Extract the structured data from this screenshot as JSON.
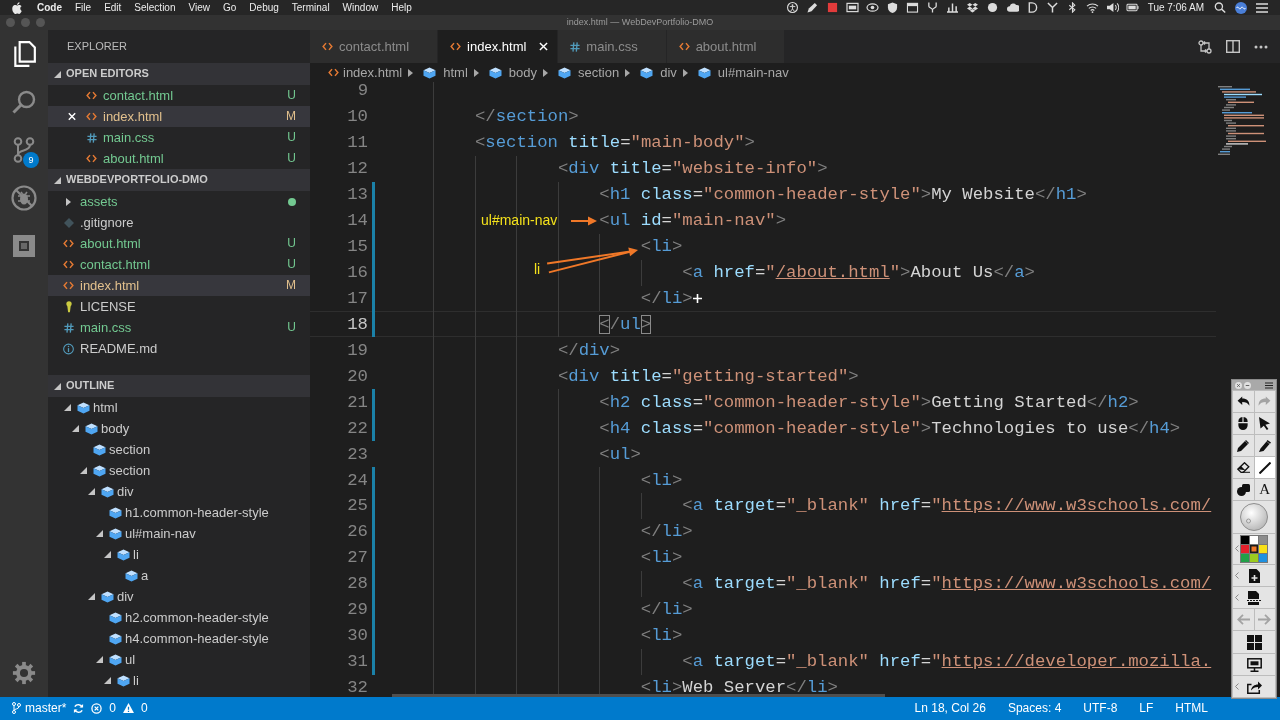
{
  "menu_bar": {
    "app": "Code",
    "menus": [
      "File",
      "Edit",
      "Selection",
      "View",
      "Go",
      "Debug",
      "Terminal",
      "Window",
      "Help"
    ],
    "clock": "Tue 7:06 AM"
  },
  "window": {
    "title": "index.html — WebDevPortfolio-DMO"
  },
  "activity_bar": {
    "items": [
      {
        "kind": "explorer",
        "selected": true
      },
      {
        "kind": "search",
        "selected": false
      },
      {
        "kind": "source_control",
        "selected": false,
        "badge": "9"
      },
      {
        "kind": "debug",
        "selected": false
      },
      {
        "kind": "extensions",
        "selected": false
      }
    ]
  },
  "sidebar": {
    "title": "EXPLORER",
    "open_editors": {
      "title": "OPEN EDITORS",
      "expanded": true,
      "items": [
        {
          "name": "contact.html",
          "kind": "html",
          "status": "U",
          "untracked": true,
          "selected": false
        },
        {
          "name": "index.html",
          "kind": "html",
          "status": "M",
          "untracked": false,
          "selected": true
        },
        {
          "name": "main.css",
          "kind": "css",
          "status": "U",
          "untracked": true,
          "selected": false
        },
        {
          "name": "about.html",
          "kind": "html",
          "status": "U",
          "untracked": true,
          "selected": false
        }
      ]
    },
    "folder": {
      "title": "WEBDEVPORTFOLIO-DMO",
      "expanded": true,
      "items": [
        {
          "name": "assets",
          "kind": "folder",
          "expanded": false,
          "untracked": true,
          "selected": false
        },
        {
          "name": ".gitignore",
          "kind": "gitignore",
          "selected": false
        },
        {
          "name": "about.html",
          "kind": "html",
          "status": "U",
          "untracked": true,
          "selected": false
        },
        {
          "name": "contact.html",
          "kind": "html",
          "status": "U",
          "untracked": true,
          "selected": false
        },
        {
          "name": "index.html",
          "kind": "html",
          "status": "M",
          "untracked": false,
          "selected": true
        },
        {
          "name": "LICENSE",
          "kind": "license",
          "selected": false
        },
        {
          "name": "main.css",
          "kind": "css",
          "status": "U",
          "untracked": true,
          "selected": false
        },
        {
          "name": "README.md",
          "kind": "readme",
          "selected": false
        }
      ]
    },
    "outline": {
      "title": "OUTLINE",
      "expanded": true,
      "items": [
        {
          "label": "html",
          "expanded": true,
          "children": [
            {
              "label": "body",
              "expanded": true,
              "children": [
                {
                  "label": "section"
                },
                {
                  "label": "section",
                  "expanded": true,
                  "children": [
                    {
                      "label": "div",
                      "expanded": true,
                      "children": [
                        {
                          "label": "h1.common-header-style"
                        },
                        {
                          "label": "ul#main-nav",
                          "expanded": true,
                          "children": [
                            {
                              "label": "li",
                              "expanded": true,
                              "children": [
                                {
                                  "label": "a"
                                }
                              ]
                            }
                          ]
                        }
                      ]
                    },
                    {
                      "label": "div",
                      "expanded": true,
                      "children": [
                        {
                          "label": "h2.common-header-style"
                        },
                        {
                          "label": "h4.common-header-style"
                        },
                        {
                          "label": "ul",
                          "expanded": true,
                          "children": [
                            {
                              "label": "li",
                              "expanded": true
                            }
                          ]
                        }
                      ]
                    }
                  ]
                }
              ]
            }
          ]
        }
      ]
    }
  },
  "tabs": [
    {
      "label": "contact.html",
      "kind": "html",
      "selected": false
    },
    {
      "label": "index.html",
      "kind": "html",
      "selected": true
    },
    {
      "label": "main.css",
      "kind": "css",
      "selected": false
    },
    {
      "label": "about.html",
      "kind": "html",
      "selected": false
    }
  ],
  "breadcrumb": [
    {
      "label": "index.html",
      "kind": "html"
    },
    {
      "label": "html",
      "kind": "element"
    },
    {
      "label": "body",
      "kind": "element"
    },
    {
      "label": "section",
      "kind": "element"
    },
    {
      "label": "div",
      "kind": "element"
    },
    {
      "label": "ul#main-nav",
      "kind": "element"
    }
  ],
  "editor": {
    "lines": [
      {
        "number": "9",
        "changed": false,
        "current": false
      },
      {
        "number": "10",
        "changed": false,
        "current": false,
        "tokens": [
          {
            "kind": "punct",
            "text": "</"
          },
          {
            "kind": "tag",
            "text": "section"
          },
          {
            "kind": "punct",
            "text": ">"
          }
        ]
      },
      {
        "number": "11",
        "changed": false,
        "current": false,
        "tokens": [
          {
            "kind": "punct",
            "text": "<"
          },
          {
            "kind": "tag",
            "text": "section"
          },
          {
            "kind": "attr",
            "text": " title"
          },
          {
            "kind": "op",
            "text": "="
          },
          {
            "kind": "string",
            "text": "\"main-body\""
          },
          {
            "kind": "punct",
            "text": ">"
          }
        ],
        "children": [
          {
            "children": [
              {
                "number": "12",
                "changed": false,
                "current": false,
                "tokens": [
                  {
                    "kind": "punct",
                    "text": "<"
                  },
                  {
                    "kind": "tag",
                    "text": "div"
                  },
                  {
                    "kind": "attr",
                    "text": " title"
                  },
                  {
                    "kind": "op",
                    "text": "="
                  },
                  {
                    "kind": "string",
                    "text": "\"website-info\""
                  },
                  {
                    "kind": "punct",
                    "text": ">"
                  }
                ],
                "children": [
                  {
                    "number": "13",
                    "changed": true,
                    "current": false,
                    "tokens": [
                      {
                        "kind": "punct",
                        "text": "<"
                      },
                      {
                        "kind": "tag",
                        "text": "h1"
                      },
                      {
                        "kind": "attr",
                        "text": " class"
                      },
                      {
                        "kind": "op",
                        "text": "="
                      },
                      {
                        "kind": "string",
                        "text": "\"common-header-style\""
                      },
                      {
                        "kind": "punct",
                        "text": ">"
                      },
                      {
                        "kind": "text",
                        "text": "My Website"
                      },
                      {
                        "kind": "punct",
                        "text": "</"
                      },
                      {
                        "kind": "tag",
                        "text": "h1"
                      },
                      {
                        "kind": "punct",
                        "text": ">"
                      }
                    ]
                  },
                  {
                    "number": "14",
                    "changed": true,
                    "current": false,
                    "tokens": [
                      {
                        "kind": "punct",
                        "text": "<"
                      },
                      {
                        "kind": "tag",
                        "text": "ul"
                      },
                      {
                        "kind": "attr",
                        "text": " id"
                      },
                      {
                        "kind": "op",
                        "text": "="
                      },
                      {
                        "kind": "string",
                        "text": "\"main-nav\""
                      },
                      {
                        "kind": "punct",
                        "text": ">"
                      }
                    ],
                    "children": [
                      {
                        "number": "15",
                        "changed": true,
                        "current": false,
                        "tokens": [
                          {
                            "kind": "punct",
                            "text": "<"
                          },
                          {
                            "kind": "tag",
                            "text": "li"
                          },
                          {
                            "kind": "punct",
                            "text": ">"
                          }
                        ],
                        "children": [
                          {
                            "number": "16",
                            "changed": true,
                            "current": false,
                            "tokens": [
                              {
                                "kind": "punct",
                                "text": "<"
                              },
                              {
                                "kind": "tag",
                                "text": "a"
                              },
                              {
                                "kind": "attr",
                                "text": " href"
                              },
                              {
                                "kind": "op",
                                "text": "="
                              },
                              {
                                "kind": "string",
                                "text": "\""
                              },
                              {
                                "kind": "link",
                                "text": "/about.html"
                              },
                              {
                                "kind": "string",
                                "text": "\""
                              },
                              {
                                "kind": "punct",
                                "text": ">"
                              },
                              {
                                "kind": "text",
                                "text": "About Us"
                              },
                              {
                                "kind": "punct",
                                "text": "</"
                              },
                              {
                                "kind": "tag",
                                "text": "a"
                              },
                              {
                                "kind": "punct",
                                "text": ">"
                              }
                            ]
                          }
                        ]
                      },
                      {
                        "number": "17",
                        "changed": true,
                        "current": false,
                        "tokens": [
                          {
                            "kind": "punct",
                            "text": "</"
                          },
                          {
                            "kind": "tag",
                            "text": "li"
                          },
                          {
                            "kind": "punct",
                            "text": ">"
                          }
                        ]
                      }
                    ]
                  },
                  {
                    "number": "18",
                    "changed": true,
                    "current": true,
                    "tokens": [
                      {
                        "kind": "bracket_match",
                        "text": "<"
                      },
                      {
                        "kind": "punct",
                        "text": "/"
                      },
                      {
                        "kind": "tag",
                        "text": "ul"
                      },
                      {
                        "kind": "bracket_match",
                        "text": ">"
                      }
                    ]
                  }
                ]
              },
              {
                "number": "19",
                "changed": false,
                "current": false,
                "tokens": [
                  {
                    "kind": "punct",
                    "text": "</"
                  },
                  {
                    "kind": "tag",
                    "text": "div"
                  },
                  {
                    "kind": "punct",
                    "text": ">"
                  }
                ]
              },
              {
                "number": "20",
                "changed": false,
                "current": false,
                "tokens": [
                  {
                    "kind": "punct",
                    "text": "<"
                  },
                  {
                    "kind": "tag",
                    "text": "div"
                  },
                  {
                    "kind": "attr",
                    "text": " title"
                  },
                  {
                    "kind": "op",
                    "text": "="
                  },
                  {
                    "kind": "string",
                    "text": "\"getting-started\""
                  },
                  {
                    "kind": "punct",
                    "text": ">"
                  }
                ],
                "children": [
                  {
                    "number": "21",
                    "changed": true,
                    "current": false,
                    "tokens": [
                      {
                        "kind": "punct",
                        "text": "<"
                      },
                      {
                        "kind": "tag",
                        "text": "h2"
                      },
                      {
                        "kind": "attr",
                        "text": " class"
                      },
                      {
                        "kind": "op",
                        "text": "="
                      },
                      {
                        "kind": "string",
                        "text": "\"common-header-style\""
                      },
                      {
                        "kind": "punct",
                        "text": ">"
                      },
                      {
                        "kind": "text",
                        "text": "Getting Started"
                      },
                      {
                        "kind": "punct",
                        "text": "</"
                      },
                      {
                        "kind": "tag",
                        "text": "h2"
                      },
                      {
                        "kind": "punct",
                        "text": ">"
                      }
                    ]
                  },
                  {
                    "number": "22",
                    "changed": true,
                    "current": false,
                    "tokens": [
                      {
                        "kind": "punct",
                        "text": "<"
                      },
                      {
                        "kind": "tag",
                        "text": "h4"
                      },
                      {
                        "kind": "attr",
                        "text": " class"
                      },
                      {
                        "kind": "op",
                        "text": "="
                      },
                      {
                        "kind": "string",
                        "text": "\"common-header-style\""
                      },
                      {
                        "kind": "punct",
                        "text": ">"
                      },
                      {
                        "kind": "text",
                        "text": "Technologies to use"
                      },
                      {
                        "kind": "punct",
                        "text": "</"
                      },
                      {
                        "kind": "tag",
                        "text": "h4"
                      },
                      {
                        "kind": "punct",
                        "text": ">"
                      }
                    ]
                  },
                  {
                    "number": "23",
                    "changed": false,
                    "current": false,
                    "tokens": [
                      {
                        "kind": "punct",
                        "text": "<"
                      },
                      {
                        "kind": "tag",
                        "text": "ul"
                      },
                      {
                        "kind": "punct",
                        "text": ">"
                      }
                    ],
                    "children": [
                      {
                        "number": "24",
                        "changed": true,
                        "current": false,
                        "tokens": [
                          {
                            "kind": "punct",
                            "text": "<"
                          },
                          {
                            "kind": "tag",
                            "text": "li"
                          },
                          {
                            "kind": "punct",
                            "text": ">"
                          }
                        ],
                        "children": [
                          {
                            "number": "25",
                            "changed": true,
                            "current": false,
                            "tokens": [
                              {
                                "kind": "punct",
                                "text": "<"
                              },
                              {
                                "kind": "tag",
                                "text": "a"
                              },
                              {
                                "kind": "attr",
                                "text": " target"
                              },
                              {
                                "kind": "op",
                                "text": "="
                              },
                              {
                                "kind": "string",
                                "text": "\"_blank\""
                              },
                              {
                                "kind": "attr",
                                "text": " href"
                              },
                              {
                                "kind": "op",
                                "text": "="
                              },
                              {
                                "kind": "string",
                                "text": "\""
                              },
                              {
                                "kind": "link",
                                "text": "https://www.w3schools.com/"
                              }
                            ]
                          }
                        ]
                      },
                      {
                        "number": "26",
                        "changed": true,
                        "current": false,
                        "tokens": [
                          {
                            "kind": "punct",
                            "text": "</"
                          },
                          {
                            "kind": "tag",
                            "text": "li"
                          },
                          {
                            "kind": "punct",
                            "text": ">"
                          }
                        ]
                      },
                      {
                        "number": "27",
                        "changed": true,
                        "current": false,
                        "tokens": [
                          {
                            "kind": "punct",
                            "text": "<"
                          },
                          {
                            "kind": "tag",
                            "text": "li"
                          },
                          {
                            "kind": "punct",
                            "text": ">"
                          }
                        ],
                        "children": [
                          {
                            "number": "28",
                            "changed": true,
                            "current": false,
                            "tokens": [
                              {
                                "kind": "punct",
                                "text": "<"
                              },
                              {
                                "kind": "tag",
                                "text": "a"
                              },
                              {
                                "kind": "attr",
                                "text": " target"
                              },
                              {
                                "kind": "op",
                                "text": "="
                              },
                              {
                                "kind": "string",
                                "text": "\"_blank\""
                              },
                              {
                                "kind": "attr",
                                "text": " href"
                              },
                              {
                                "kind": "op",
                                "text": "="
                              },
                              {
                                "kind": "string",
                                "text": "\""
                              },
                              {
                                "kind": "link",
                                "text": "https://www.w3schools.com/"
                              }
                            ]
                          }
                        ]
                      },
                      {
                        "number": "29",
                        "changed": true,
                        "current": false,
                        "tokens": [
                          {
                            "kind": "punct",
                            "text": "</"
                          },
                          {
                            "kind": "tag",
                            "text": "li"
                          },
                          {
                            "kind": "punct",
                            "text": ">"
                          }
                        ]
                      },
                      {
                        "number": "30",
                        "changed": true,
                        "current": false,
                        "tokens": [
                          {
                            "kind": "punct",
                            "text": "<"
                          },
                          {
                            "kind": "tag",
                            "text": "li"
                          },
                          {
                            "kind": "punct",
                            "text": ">"
                          }
                        ],
                        "children": [
                          {
                            "number": "31",
                            "changed": true,
                            "current": false,
                            "tokens": [
                              {
                                "kind": "punct",
                                "text": "<"
                              },
                              {
                                "kind": "tag",
                                "text": "a"
                              },
                              {
                                "kind": "attr",
                                "text": " target"
                              },
                              {
                                "kind": "op",
                                "text": "="
                              },
                              {
                                "kind": "string",
                                "text": "\"_blank\""
                              },
                              {
                                "kind": "attr",
                                "text": " href"
                              },
                              {
                                "kind": "op",
                                "text": "="
                              },
                              {
                                "kind": "string",
                                "text": "\""
                              },
                              {
                                "kind": "link",
                                "text": "https://developer.mozilla."
                              }
                            ]
                          }
                        ]
                      },
                      {
                        "number": "32",
                        "changed": false,
                        "current": false,
                        "tokens": [
                          {
                            "kind": "punct",
                            "text": "<"
                          },
                          {
                            "kind": "tag",
                            "text": "li"
                          },
                          {
                            "kind": "punct",
                            "text": ">"
                          },
                          {
                            "kind": "text",
                            "text": "Web Server"
                          },
                          {
                            "kind": "punct",
                            "text": "</"
                          },
                          {
                            "kind": "tag",
                            "text": "li"
                          },
                          {
                            "kind": "punct",
                            "text": ">"
                          }
                        ]
                      }
                    ]
                  }
                ]
              }
            ]
          }
        ]
      }
    ]
  },
  "annotations": [
    {
      "kind": "arrow",
      "text": "ul#main-nav"
    },
    {
      "kind": "double_arrow",
      "text": "li"
    }
  ],
  "status_bar": {
    "branch": "master*",
    "errors": "0",
    "warnings": "0",
    "cursor": "Ln 18, Col 26",
    "indentation": "Spaces: 4",
    "encoding": "UTF-8",
    "line_ending": "LF",
    "language": "HTML"
  },
  "drawing_toolbar": {
    "tools": [
      {
        "kind": "undo",
        "selected": false,
        "disabled": false
      },
      {
        "kind": "redo",
        "selected": false,
        "disabled": true
      },
      {
        "kind": "mouse",
        "selected": false,
        "disabled": false
      },
      {
        "kind": "pointer",
        "selected": false,
        "disabled": false
      },
      {
        "kind": "pencil",
        "selected": false,
        "disabled": false
      },
      {
        "kind": "marker",
        "selected": false,
        "disabled": false
      },
      {
        "kind": "eraser",
        "selected": false,
        "disabled": false
      },
      {
        "kind": "line",
        "selected": true,
        "disabled": false
      },
      {
        "kind": "shapes",
        "selected": false,
        "disabled": false
      },
      {
        "kind": "text",
        "label": "A",
        "selected": false,
        "disabled": false
      },
      {
        "kind": "brush_size",
        "selected": false,
        "disabled": false
      },
      {
        "kind": "palette",
        "selected": false,
        "disabled": false
      },
      {
        "kind": "new_page",
        "selected": false,
        "disabled": false
      },
      {
        "kind": "capture_page",
        "selected": false,
        "disabled": false
      },
      {
        "kind": "back",
        "selected": false,
        "disabled": true
      },
      {
        "kind": "forward",
        "selected": false,
        "disabled": true
      },
      {
        "kind": "grid",
        "selected": false,
        "disabled": false
      },
      {
        "kind": "screen",
        "selected": false,
        "disabled": false
      },
      {
        "kind": "share",
        "selected": false,
        "disabled": false
      }
    ],
    "swatches": [
      {
        "color": "#000000",
        "selected": false
      },
      {
        "color": "#ffffff",
        "selected": false
      },
      {
        "color": "#8c8c8c",
        "selected": false
      },
      {
        "color": "#e3202b",
        "selected": false
      },
      {
        "color": "#f07828",
        "selected": true
      },
      {
        "color": "#f8e018",
        "selected": false
      },
      {
        "color": "#20a048",
        "selected": false
      },
      {
        "color": "#9ccc20",
        "selected": false
      },
      {
        "color": "#1e90e0",
        "selected": false
      }
    ]
  }
}
